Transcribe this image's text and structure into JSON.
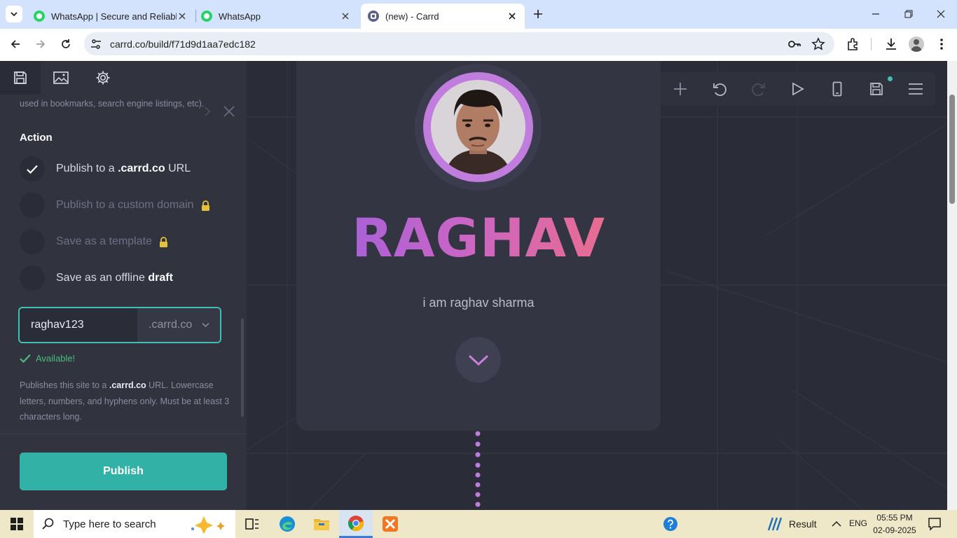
{
  "browser": {
    "tabs": [
      {
        "title": "WhatsApp | Secure and Reliable"
      },
      {
        "title": "WhatsApp"
      },
      {
        "title": "(new) - Carrd"
      }
    ],
    "url": "carrd.co/build/f71d9d1aa7edc182"
  },
  "panel": {
    "truncated_help": "used in bookmarks, search engine listings, etc).",
    "action_heading": "Action",
    "options": [
      {
        "pre": "Publish to a ",
        "bold": ".carrd.co",
        "post": " URL",
        "checked": true,
        "locked": false
      },
      {
        "pre": "Publish to a custom domain",
        "bold": "",
        "post": "",
        "checked": false,
        "locked": true
      },
      {
        "pre": "Save as a template",
        "bold": "",
        "post": "",
        "checked": false,
        "locked": true
      },
      {
        "pre": "Save as an offline ",
        "bold": "draft",
        "post": "",
        "checked": false,
        "locked": false
      }
    ],
    "url_input_value": "raghav123",
    "url_suffix": ".carrd.co",
    "status": "Available!",
    "help_pre": "Publishes this site to a ",
    "help_bold": ".carrd.co",
    "help_post": " URL. Lowercase letters, numbers, and hyphens only. Must be at least 3 characters long.",
    "publish_label": "Publish"
  },
  "canvas": {
    "title": "RAGHAV",
    "subtitle": "i am raghav sharma"
  },
  "taskbar": {
    "search_placeholder": "Type here to search",
    "weather": "Result",
    "lang": "ENG",
    "time": "05:55 PM",
    "date": "02-09-2025"
  },
  "colors": {
    "accent": "#32b1a6",
    "panel_bg": "#31333f",
    "canvas_bg": "#2a2c37",
    "avatar_ring": "#c07dde",
    "title_gradient": [
      "#9b5fe0",
      "#f5707c"
    ]
  }
}
